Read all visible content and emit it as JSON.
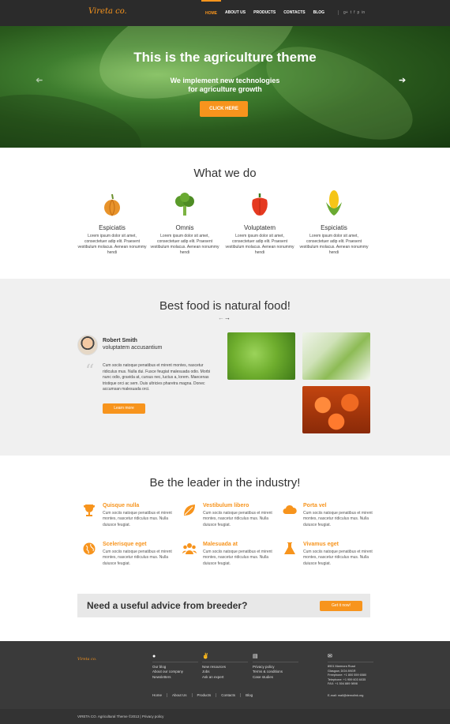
{
  "header": {
    "logo": "Vireta co.",
    "nav": [
      "HOME",
      "ABOUT US",
      "PRODUCTS",
      "CONTACTS",
      "BLOG"
    ],
    "socials": [
      "g+",
      "t",
      "f",
      "p",
      "in"
    ]
  },
  "hero": {
    "title": "This is the agriculture theme",
    "subtitle_line1": "We implement new technologies",
    "subtitle_line2": "for agriculture growth",
    "button": "CLICK HERE",
    "prev_icon": "arrow-left-icon",
    "next_icon": "arrow-right-icon"
  },
  "what_we_do": {
    "title": "What we do",
    "features": [
      {
        "icon": "onion-icon",
        "title": "Espiciatis",
        "text": "Lorem ipsum dolor sit amet, consectetuer adip elit. Praesent vestibulum molacus. Aenean nonummy hendi"
      },
      {
        "icon": "broccoli-icon",
        "title": "Omnis",
        "text": "Lorem ipsum dolor sit amet, consectetuer adip elit. Praesent vestibulum molacus. Aenean nonummy hendi"
      },
      {
        "icon": "pepper-icon",
        "title": "Voluptatem",
        "text": "Lorem ipsum dolor sit amet, consectetuer adip elit. Praesent vestibulum molacus. Aenean nonummy hendi"
      },
      {
        "icon": "corn-icon",
        "title": "Espiciatis",
        "text": "Lorem ipsum dolor sit amet, consectetuer adip elit. Praesent vestibulum molacus. Aenean nonummy hendi"
      }
    ]
  },
  "best_food": {
    "title": "Best food is natural food!",
    "name": "Robert Smith",
    "role": "voluptatem accusantium",
    "quote": "Cum sociis natoque penatibus et mirent montes, nascetur ridiculus mus. Nulla dui. Fusce feugiat malesuada odio. Morbi nunc odio, gravida at, cursus nec, luctus a, lorem. Maecenas tristique orci ac sem. Duis ultricies pharetra magna. Donec accumsan malesuada orci.",
    "button": "Learn more"
  },
  "leader": {
    "title": "Be the leader in the industry!",
    "items": [
      {
        "icon": "trophy-icon",
        "title": "Quisque nulla",
        "text": "Cum sociis natoque penatibus et mirent montes, nascetur ridiculus mus. Nulla duiusce feugiat."
      },
      {
        "icon": "leaf-icon",
        "title": "Vestibulum libero",
        "text": "Cum sociis natoque penatibus et mirent montes, nascetur ridiculus mus. Nulla duiusce feugiat."
      },
      {
        "icon": "cloud-icon",
        "title": "Porta vel",
        "text": "Cum sociis natoque penatibus et mirent montes, nascetur ridiculus mus. Nulla duiusce feugiat."
      },
      {
        "icon": "globe-icon",
        "title": "Scelerisque eget",
        "text": "Cum sociis natoque penatibus et mirent montes, nascetur ridiculus mus. Nulla duiusce feugiat."
      },
      {
        "icon": "people-icon",
        "title": "Malesuada at",
        "text": "Cum sociis natoque penatibus et mirent montes, nascetur ridiculus mus. Nulla duiusce feugiat."
      },
      {
        "icon": "flask-icon",
        "title": "Vivamus eget",
        "text": "Cum sociis natoque penatibus et mirent montes, nascetur ridiculus mus. Nulla duiusce feugiat."
      }
    ]
  },
  "advice": {
    "text": "Need a useful advice from breeder?",
    "button": "Get it now!"
  },
  "footer": {
    "logo": "Vireta co.",
    "col1": [
      "Our blog",
      "About our company",
      "Newsletters"
    ],
    "col2": [
      "New resources",
      "Jobs",
      "Ask an expert"
    ],
    "col3": [
      "Privacy policy",
      "Terms & conditions",
      "Case studies"
    ],
    "address": [
      "8901 Marmora Road",
      "Glasgow, DO4 89GR",
      "Freephone:   +1 800 559 6580",
      "Telephone:   +1 959 603 6035",
      "FAX:         +1 504 889 9898"
    ],
    "email": "E-mail: mail@demolink.org",
    "nav": [
      "Home",
      "About Us",
      "Products",
      "Contacts",
      "Blog"
    ],
    "copyright": "VIRETA CO. Agricultural Theme ©2013 | Privacy policy"
  },
  "colors": {
    "accent": "#f7941d",
    "header": "#2b2b2b",
    "footer": "#3a3a3a",
    "band": "#f0f0f0"
  }
}
